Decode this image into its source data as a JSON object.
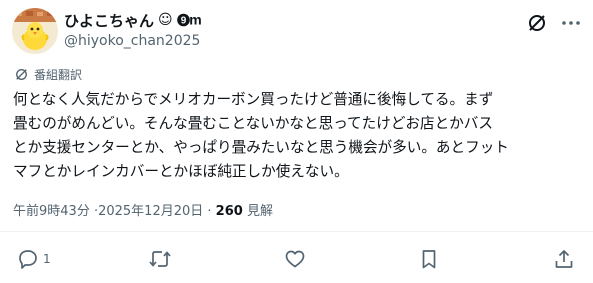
{
  "author": {
    "display_name": "ひよこちゃん",
    "name_emoji": "☺︎",
    "handle": "@hiyoko_chan2025"
  },
  "header": {
    "icons": [
      "slash-icon",
      "more-icon"
    ]
  },
  "translate_label": "番組翻訳",
  "post": {
    "lines": [
      "何となく人気だからでメリオカーボン買ったけど普通に後悔してる。まず",
      "畳むのがめんどい。そんな畳むことないかなと思ってたけどお店とかバス",
      "とか支援センターとか、やっぱり畳みたいなと思う機会が多い。あとフット",
      "マフとかレインカバーとかほぼ純正しか使えない。"
    ]
  },
  "meta": {
    "time": "午前9時43分",
    "date": "2025年12月20日",
    "views_count": "260",
    "views_label": "見解"
  },
  "actions": {
    "reply_count": "1",
    "icons": [
      "reply-icon",
      "repost-icon",
      "like-icon",
      "bookmark-icon",
      "share-icon"
    ]
  },
  "colors": {
    "text": "#0f1419",
    "secondary": "#536471",
    "divider": "#eff3f4",
    "icon": "#536471"
  }
}
